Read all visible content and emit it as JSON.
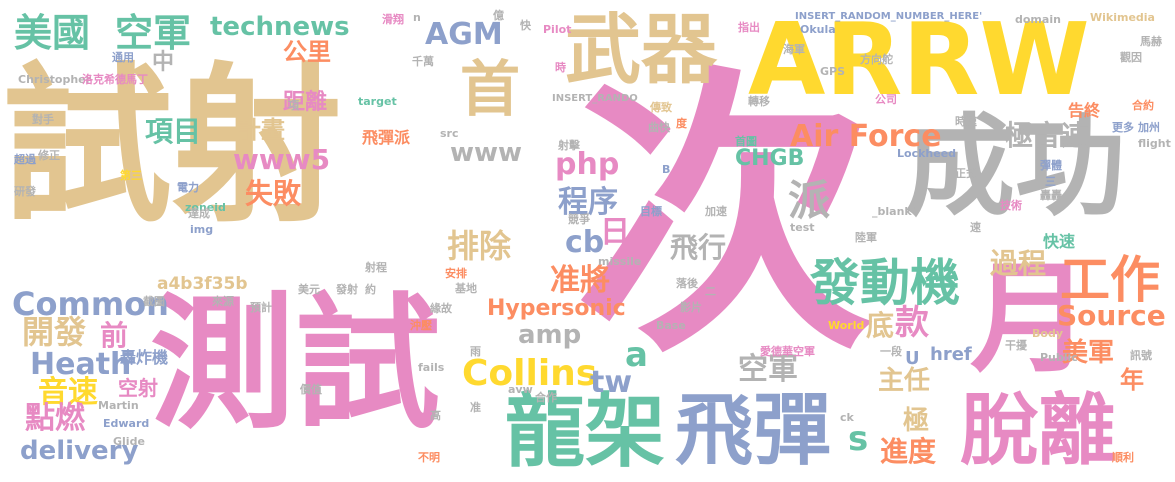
{
  "palette": {
    "tan": "#e2c590",
    "pink": "#e78ac3",
    "yellow": "#ffd92f",
    "gray": "#b3b3b3",
    "blue": "#8da0cb",
    "green": "#66c2a5",
    "orange": "#fc8d62",
    "lime": "#a6d854"
  },
  "words": [
    {
      "text": "試射",
      "c": "#e2c590"
    },
    {
      "text": "次",
      "c": "#e78ac3"
    },
    {
      "text": "ARRW",
      "c": "#ffd92f"
    },
    {
      "text": "測試",
      "c": "#e78ac3"
    },
    {
      "text": "成功",
      "c": "#b3b3b3"
    },
    {
      "text": "武器",
      "c": "#e2c590"
    },
    {
      "text": "月",
      "c": "#e78ac3"
    },
    {
      "text": "龍架",
      "c": "#66c2a5"
    },
    {
      "text": "飛彈",
      "c": "#8da0cb"
    },
    {
      "text": "脫離",
      "c": "#e78ac3"
    },
    {
      "text": "發動機",
      "c": "#66c2a5"
    },
    {
      "text": "工作",
      "c": "#fc8d62"
    },
    {
      "text": "首",
      "c": "#e2c590"
    },
    {
      "text": "美國",
      "c": "#66c2a5"
    },
    {
      "text": "空軍",
      "c": "#66c2a5"
    },
    {
      "text": "technews",
      "c": "#66c2a5"
    },
    {
      "text": "AGM",
      "c": "#8da0cb"
    },
    {
      "text": "公里",
      "c": "#fc8d62"
    },
    {
      "text": "中",
      "c": "#b3b3b3"
    },
    {
      "text": "Air Force",
      "c": "#fc8d62"
    },
    {
      "text": "www",
      "c": "#b3b3b3"
    },
    {
      "text": "www5",
      "c": "#e78ac3"
    },
    {
      "text": "極音速",
      "c": "#b3b3b3"
    },
    {
      "text": "項目",
      "c": "#66c2a5"
    },
    {
      "text": "計畫",
      "c": "#e2c590"
    },
    {
      "text": "距離",
      "c": "#e78ac3"
    },
    {
      "text": "失敗",
      "c": "#fc8d62"
    },
    {
      "text": "php",
      "c": "#e78ac3"
    },
    {
      "text": "程序",
      "c": "#8da0cb"
    },
    {
      "text": "cb",
      "c": "#8da0cb"
    },
    {
      "text": "日",
      "c": "#e78ac3"
    },
    {
      "text": "CHGB",
      "c": "#66c2a5"
    },
    {
      "text": "派",
      "c": "#b3b3b3"
    },
    {
      "text": "排除",
      "c": "#e2c590"
    },
    {
      "text": "飛行",
      "c": "#b3b3b3"
    },
    {
      "text": "准將",
      "c": "#fc8d62"
    },
    {
      "text": "過程",
      "c": "#e2c590"
    },
    {
      "text": "Common",
      "c": "#8da0cb"
    },
    {
      "text": "開發",
      "c": "#e2c590"
    },
    {
      "text": "前",
      "c": "#e78ac3"
    },
    {
      "text": "Heath",
      "c": "#8da0cb"
    },
    {
      "text": "音速",
      "c": "#ffd92f"
    },
    {
      "text": "點燃",
      "c": "#e78ac3"
    },
    {
      "text": "delivery",
      "c": "#8da0cb"
    },
    {
      "text": "amp",
      "c": "#b3b3b3"
    },
    {
      "text": "a",
      "c": "#66c2a5"
    },
    {
      "text": "Collins",
      "c": "#ffd92f"
    },
    {
      "text": "tw",
      "c": "#8da0cb"
    },
    {
      "text": "Hypersonic",
      "c": "#fc8d62"
    },
    {
      "text": "空軍",
      "c": "#b3b3b3"
    },
    {
      "text": "s",
      "c": "#66c2a5"
    },
    {
      "text": "底",
      "c": "#e2c590"
    },
    {
      "text": "款",
      "c": "#e78ac3"
    },
    {
      "text": "Source",
      "c": "#fc8d62"
    },
    {
      "text": "美軍",
      "c": "#fc8d62"
    },
    {
      "text": "主任",
      "c": "#e2c590"
    },
    {
      "text": "年",
      "c": "#fc8d62"
    },
    {
      "text": "極",
      "c": "#e2c590"
    },
    {
      "text": "進度",
      "c": "#fc8d62"
    },
    {
      "text": "飛彈派",
      "c": "#fc8d62"
    },
    {
      "text": "a4b3f35b",
      "c": "#e2c590"
    },
    {
      "text": "空射",
      "c": "#e78ac3"
    },
    {
      "text": "轟炸機",
      "c": "#8da0cb"
    },
    {
      "text": "U",
      "c": "#8da0cb"
    },
    {
      "text": "href",
      "c": "#8da0cb"
    },
    {
      "text": "告終",
      "c": "#fc8d62"
    },
    {
      "text": "快速",
      "c": "#66c2a5"
    },
    {
      "text": "通用",
      "c": "#8da0cb"
    },
    {
      "text": "Christopher",
      "c": "#b3b3b3"
    },
    {
      "text": "洛克希德馬丁",
      "c": "#e78ac3"
    },
    {
      "text": "對手",
      "c": "#b3b3b3"
    },
    {
      "text": "超過",
      "c": "#8da0cb"
    },
    {
      "text": "修正",
      "c": "#b3b3b3"
    },
    {
      "text": "研發",
      "c": "#b3b3b3"
    },
    {
      "text": "第三",
      "c": "#ffd92f"
    },
    {
      "text": "電力",
      "c": "#8da0cb"
    },
    {
      "text": "zoneid",
      "c": "#66c2a5"
    },
    {
      "text": "img",
      "c": "#8da0cb"
    },
    {
      "text": "達成",
      "c": "#b3b3b3"
    },
    {
      "text": "target",
      "c": "#66c2a5"
    },
    {
      "text": "滑翔",
      "c": "#e78ac3"
    },
    {
      "text": "n",
      "c": "#b3b3b3"
    },
    {
      "text": "億",
      "c": "#b3b3b3"
    },
    {
      "text": "快",
      "c": "#b3b3b3"
    },
    {
      "text": "Pilot",
      "c": "#e78ac3"
    },
    {
      "text": "指出",
      "c": "#e78ac3"
    },
    {
      "text": "INSERT_RANDOM_NUMBER_HERE'",
      "c": "#8da0cb"
    },
    {
      "text": "domain",
      "c": "#b3b3b3"
    },
    {
      "text": "Wikimedia",
      "c": "#e2c590"
    },
    {
      "text": "Okula",
      "c": "#8da0cb"
    },
    {
      "text": "海軍",
      "c": "#b3b3b3"
    },
    {
      "text": "馬赫",
      "c": "#b3b3b3"
    },
    {
      "text": "觀因",
      "c": "#b3b3b3"
    },
    {
      "text": "方向舵",
      "c": "#b3b3b3"
    },
    {
      "text": "GPS",
      "c": "#b3b3b3"
    },
    {
      "text": "合約",
      "c": "#fc8d62"
    },
    {
      "text": "時",
      "c": "#e78ac3"
    },
    {
      "text": "千萬",
      "c": "#b3b3b3"
    },
    {
      "text": "INSERT_RANDO",
      "c": "#b3b3b3"
    },
    {
      "text": "傳致",
      "c": "#e2c590"
    },
    {
      "text": "轉移",
      "c": "#b3b3b3"
    },
    {
      "text": "公司",
      "c": "#e78ac3"
    },
    {
      "text": "度",
      "c": "#fc8d62"
    },
    {
      "text": "曲快",
      "c": "#b3b3b3"
    },
    {
      "text": "首圖",
      "c": "#66c2a5"
    },
    {
      "text": "時速",
      "c": "#b3b3b3"
    },
    {
      "text": "更多",
      "c": "#8da0cb"
    },
    {
      "text": "加州",
      "c": "#8da0cb"
    },
    {
      "text": "flight",
      "c": "#b3b3b3"
    },
    {
      "text": "Lockheed",
      "c": "#8da0cb"
    },
    {
      "text": "正式",
      "c": "#b3b3b3"
    },
    {
      "text": "彈體",
      "c": "#8da0cb"
    },
    {
      "text": "三",
      "c": "#8da0cb"
    },
    {
      "text": "轟轟",
      "c": "#b3b3b3"
    },
    {
      "text": "技術",
      "c": "#e78ac3"
    },
    {
      "text": "速",
      "c": "#b3b3b3"
    },
    {
      "text": "src",
      "c": "#b3b3b3"
    },
    {
      "text": "射擊",
      "c": "#b3b3b3"
    },
    {
      "text": "B",
      "c": "#8da0cb"
    },
    {
      "text": "目標",
      "c": "#8da0cb"
    },
    {
      "text": "競爭",
      "c": "#b3b3b3"
    },
    {
      "text": "加速",
      "c": "#b3b3b3"
    },
    {
      "text": "test",
      "c": "#b3b3b3"
    },
    {
      "text": "陸軍",
      "c": "#b3b3b3"
    },
    {
      "text": "_blank'",
      "c": "#b3b3b3"
    },
    {
      "text": "missile",
      "c": "#b3b3b3"
    },
    {
      "text": "射程",
      "c": "#b3b3b3"
    },
    {
      "text": "安排",
      "c": "#fc8d62"
    },
    {
      "text": "發射",
      "c": "#b3b3b3"
    },
    {
      "text": "約",
      "c": "#b3b3b3"
    },
    {
      "text": "美元",
      "c": "#b3b3b3"
    },
    {
      "text": "基地",
      "c": "#b3b3b3"
    },
    {
      "text": "落後",
      "c": "#b3b3b3"
    },
    {
      "text": "二",
      "c": "#b3b3b3"
    },
    {
      "text": "影片",
      "c": "#b3b3b3"
    },
    {
      "text": "預計",
      "c": "#b3b3b3"
    },
    {
      "text": "截圖",
      "c": "#b3b3b3"
    },
    {
      "text": "來源",
      "c": "#b3b3b3"
    },
    {
      "text": "緣故",
      "c": "#b3b3b3"
    },
    {
      "text": "沖壓",
      "c": "#fc8d62"
    },
    {
      "text": "Base",
      "c": "#b3b3b3"
    },
    {
      "text": "World",
      "c": "#ffd92f"
    },
    {
      "text": "Body",
      "c": "#e2c590"
    },
    {
      "text": "干擾",
      "c": "#b3b3b3"
    },
    {
      "text": "Public",
      "c": "#b3b3b3"
    },
    {
      "text": "雨",
      "c": "#b3b3b3"
    },
    {
      "text": "一段",
      "c": "#b3b3b3"
    },
    {
      "text": "愛德華空軍",
      "c": "#e78ac3"
    },
    {
      "text": "訊號",
      "c": "#b3b3b3"
    },
    {
      "text": "價值",
      "c": "#b3b3b3"
    },
    {
      "text": "fails",
      "c": "#b3b3b3"
    },
    {
      "text": "avw",
      "c": "#b3b3b3"
    },
    {
      "text": "合作",
      "c": "#b3b3b3"
    },
    {
      "text": "准",
      "c": "#b3b3b3"
    },
    {
      "text": "Martin",
      "c": "#b3b3b3"
    },
    {
      "text": "Edward",
      "c": "#8da0cb"
    },
    {
      "text": "Glide",
      "c": "#b3b3b3"
    },
    {
      "text": "不明",
      "c": "#fc8d62"
    },
    {
      "text": "ck",
      "c": "#b3b3b3"
    },
    {
      "text": "順利",
      "c": "#fc8d62"
    },
    {
      "text": "高",
      "c": "#b3b3b3"
    },
    {
      "text": "項",
      "c": "#b3b3b3"
    }
  ]
}
